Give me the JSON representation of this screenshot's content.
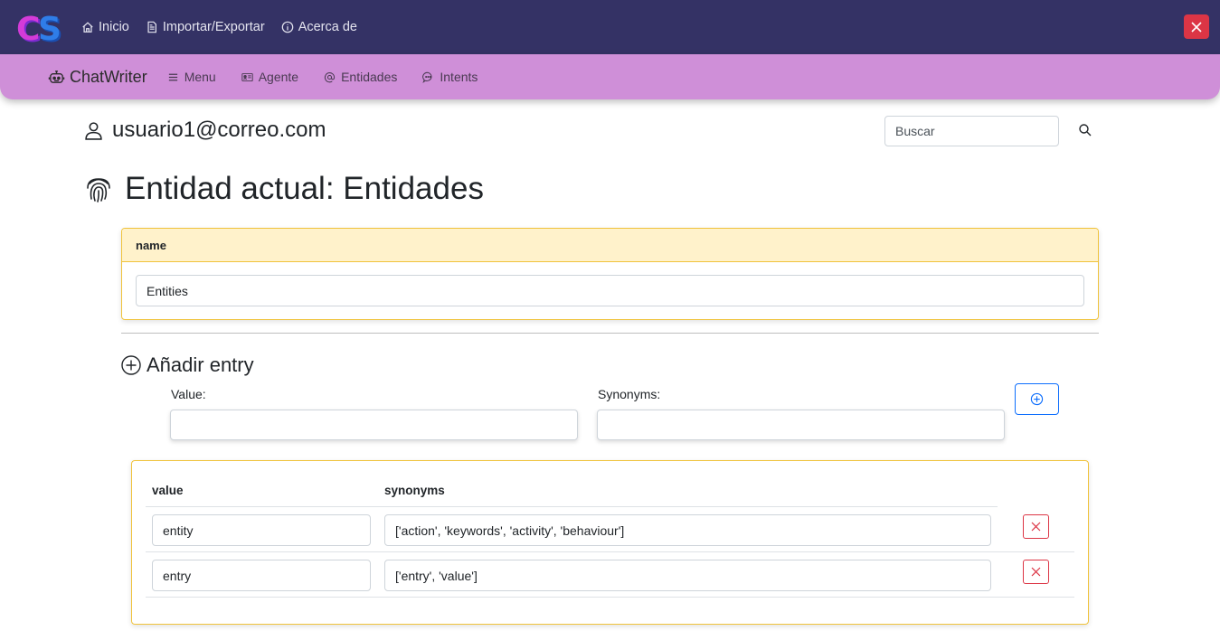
{
  "topbar": {
    "logo_text": "CS",
    "nav": [
      {
        "label": "Inicio",
        "icon": "house-icon"
      },
      {
        "label": "Importar/Exportar",
        "icon": "file-icon"
      },
      {
        "label": "Acerca de",
        "icon": "info-circle-icon"
      }
    ],
    "close_icon": "close-icon",
    "close_color": "#dc3545",
    "bg_color": "#343265"
  },
  "subbar": {
    "brand": "ChatWriter",
    "nav": [
      {
        "label": "Menu",
        "icon": "list-icon"
      },
      {
        "label": "Agente",
        "icon": "id-card-icon"
      },
      {
        "label": "Entidades",
        "icon": "at-icon"
      },
      {
        "label": "Intents",
        "icon": "chat-dots-icon"
      }
    ],
    "bg_color": "#cf8fd8"
  },
  "user": {
    "email": "usuario1@correo.com"
  },
  "search": {
    "placeholder": "Buscar"
  },
  "page_title": "Entidad actual: Entidades",
  "name_card": {
    "header": "name",
    "value": "Entities"
  },
  "add_entry": {
    "title": "Añadir entry",
    "value_label": "Value:",
    "synonyms_label": "Synonyms:",
    "value_input": "",
    "synonyms_input": ""
  },
  "table": {
    "headers": {
      "value": "value",
      "synonyms": "synonyms"
    },
    "rows": [
      {
        "value": "entity",
        "synonyms": "['action', 'keywords', 'activity', 'behaviour']"
      },
      {
        "value": "entry",
        "synonyms": "['entry', 'value']"
      }
    ]
  },
  "accent_colors": {
    "card_border": "#f0c33c",
    "card_header": "#fff2cb",
    "primary": "#0d6efd",
    "danger": "#dc3545"
  }
}
